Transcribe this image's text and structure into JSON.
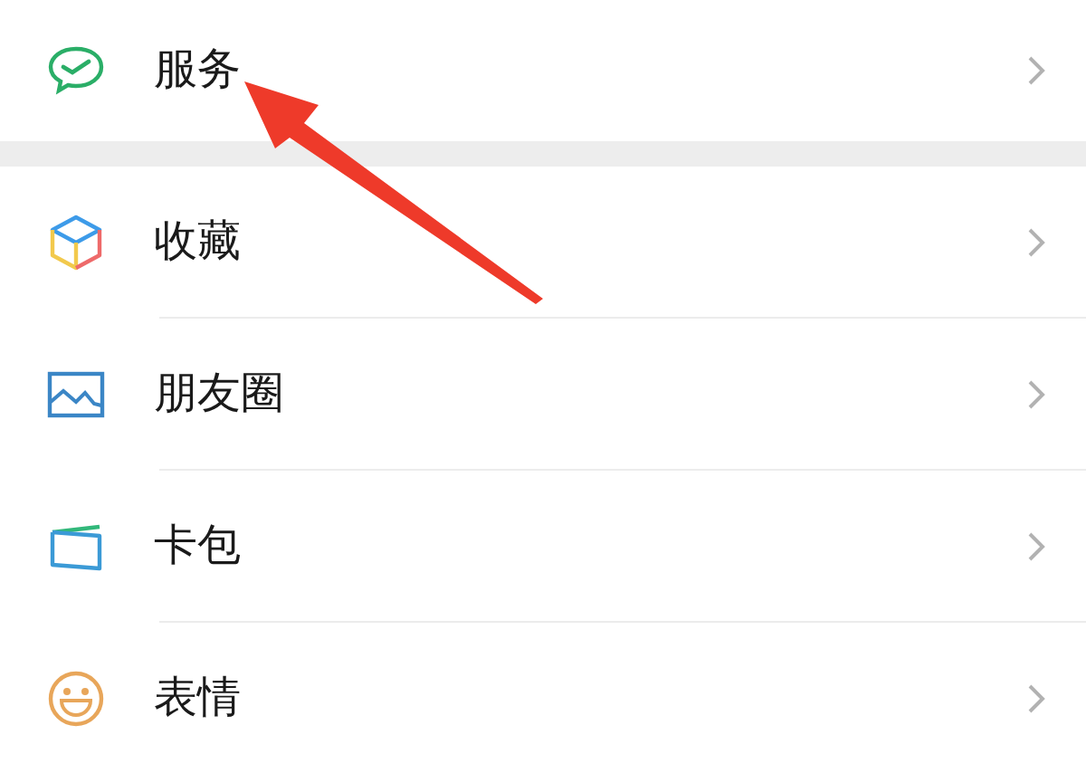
{
  "groups": [
    {
      "items": [
        {
          "label": "服务",
          "kind": "service"
        }
      ]
    },
    {
      "items": [
        {
          "label": "收藏",
          "kind": "favorites"
        },
        {
          "label": "朋友圈",
          "kind": "moments"
        },
        {
          "label": "卡包",
          "kind": "cards"
        },
        {
          "label": "表情",
          "kind": "stickers"
        }
      ]
    }
  ]
}
